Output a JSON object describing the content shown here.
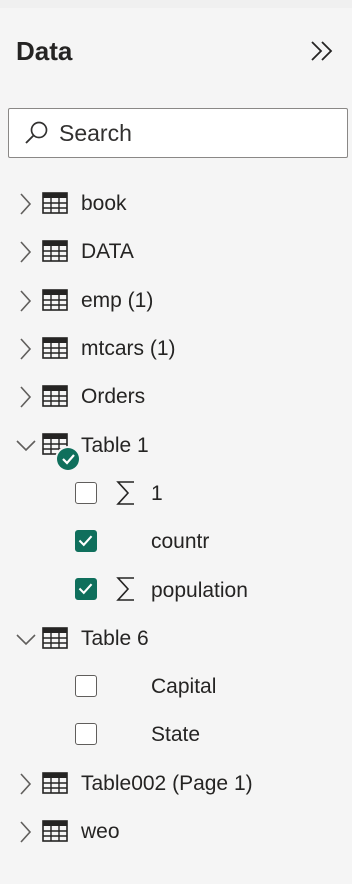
{
  "pane": {
    "title": "Data",
    "collapse_icon": "double-chevron-right-icon"
  },
  "search": {
    "placeholder": "Search",
    "icon": "search-icon"
  },
  "tables": [
    {
      "name": "book",
      "expanded": false
    },
    {
      "name": "DATA",
      "expanded": false
    },
    {
      "name": "emp (1)",
      "expanded": false
    },
    {
      "name": "mtcars (1)",
      "expanded": false
    },
    {
      "name": "Orders",
      "expanded": false
    },
    {
      "name": "Table 1",
      "expanded": true,
      "in_use": true,
      "fields": [
        {
          "name": "1",
          "checked": false,
          "sum": true
        },
        {
          "name": "countr",
          "checked": true,
          "sum": false
        },
        {
          "name": "population",
          "checked": true,
          "sum": true
        }
      ]
    },
    {
      "name": "Table 6",
      "expanded": true,
      "fields": [
        {
          "name": "Capital",
          "checked": false,
          "sum": false
        },
        {
          "name": "State",
          "checked": false,
          "sum": false
        }
      ]
    },
    {
      "name": "Table002 (Page 1)",
      "expanded": false
    },
    {
      "name": "weo",
      "expanded": false
    }
  ],
  "colors": {
    "accent": "#0f6f5c",
    "text": "#252423",
    "background": "#f5f5f5"
  }
}
